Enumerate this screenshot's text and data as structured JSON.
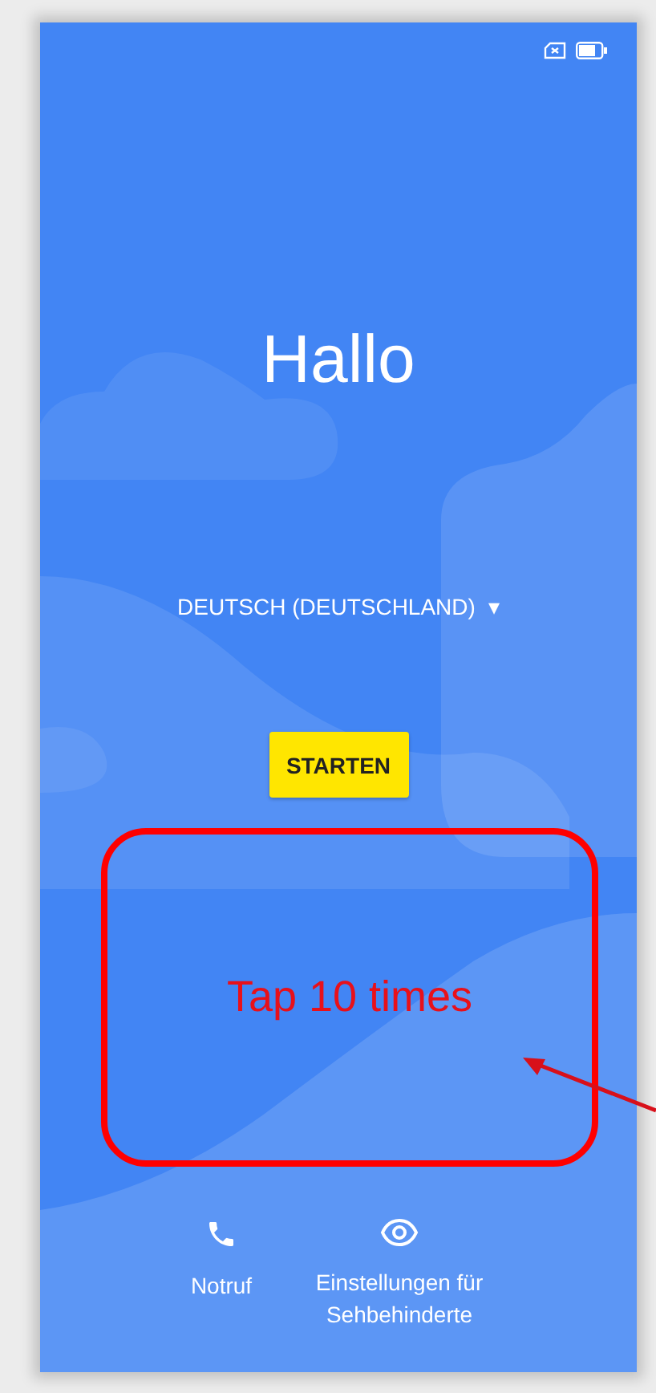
{
  "title": "Hallo",
  "language": {
    "label": "DEUTSCH (DEUTSCHLAND)",
    "caret": "▾"
  },
  "start_button": "STARTEN",
  "annotation": {
    "text": "Tap 10 times"
  },
  "actions": [
    {
      "kind": "phone",
      "label": "Notruf"
    },
    {
      "kind": "eye",
      "label": "Einstellungen für Sehbehinderte"
    }
  ]
}
